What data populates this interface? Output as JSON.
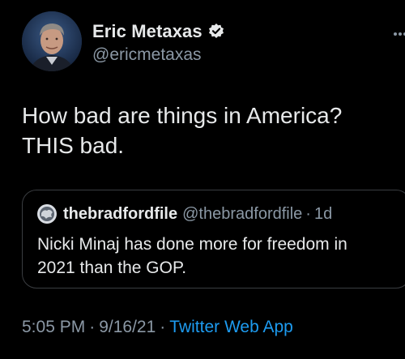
{
  "author": {
    "display_name": "Eric Metaxas",
    "handle": "@ericmetaxas",
    "verified_icon": "verified-badge-icon"
  },
  "tweet": {
    "line1": "How bad are things in America?",
    "line2": "THIS bad."
  },
  "quote": {
    "name": "thebradfordfile",
    "handle": "@thebradfordfile",
    "separator": "·",
    "time": "1d",
    "line1": "Nicki Minaj has done more for freedom in",
    "line2": "2021 than the GOP."
  },
  "meta": {
    "time": "5:05 PM",
    "sep1": "·",
    "date": "9/16/21",
    "sep2": "·",
    "source": "Twitter Web App"
  },
  "colors": {
    "background": "#000000",
    "primary_text": "#e7e9ea",
    "secondary_text": "#8b98a5",
    "link": "#1d9bf0",
    "border": "#3a3d41"
  }
}
